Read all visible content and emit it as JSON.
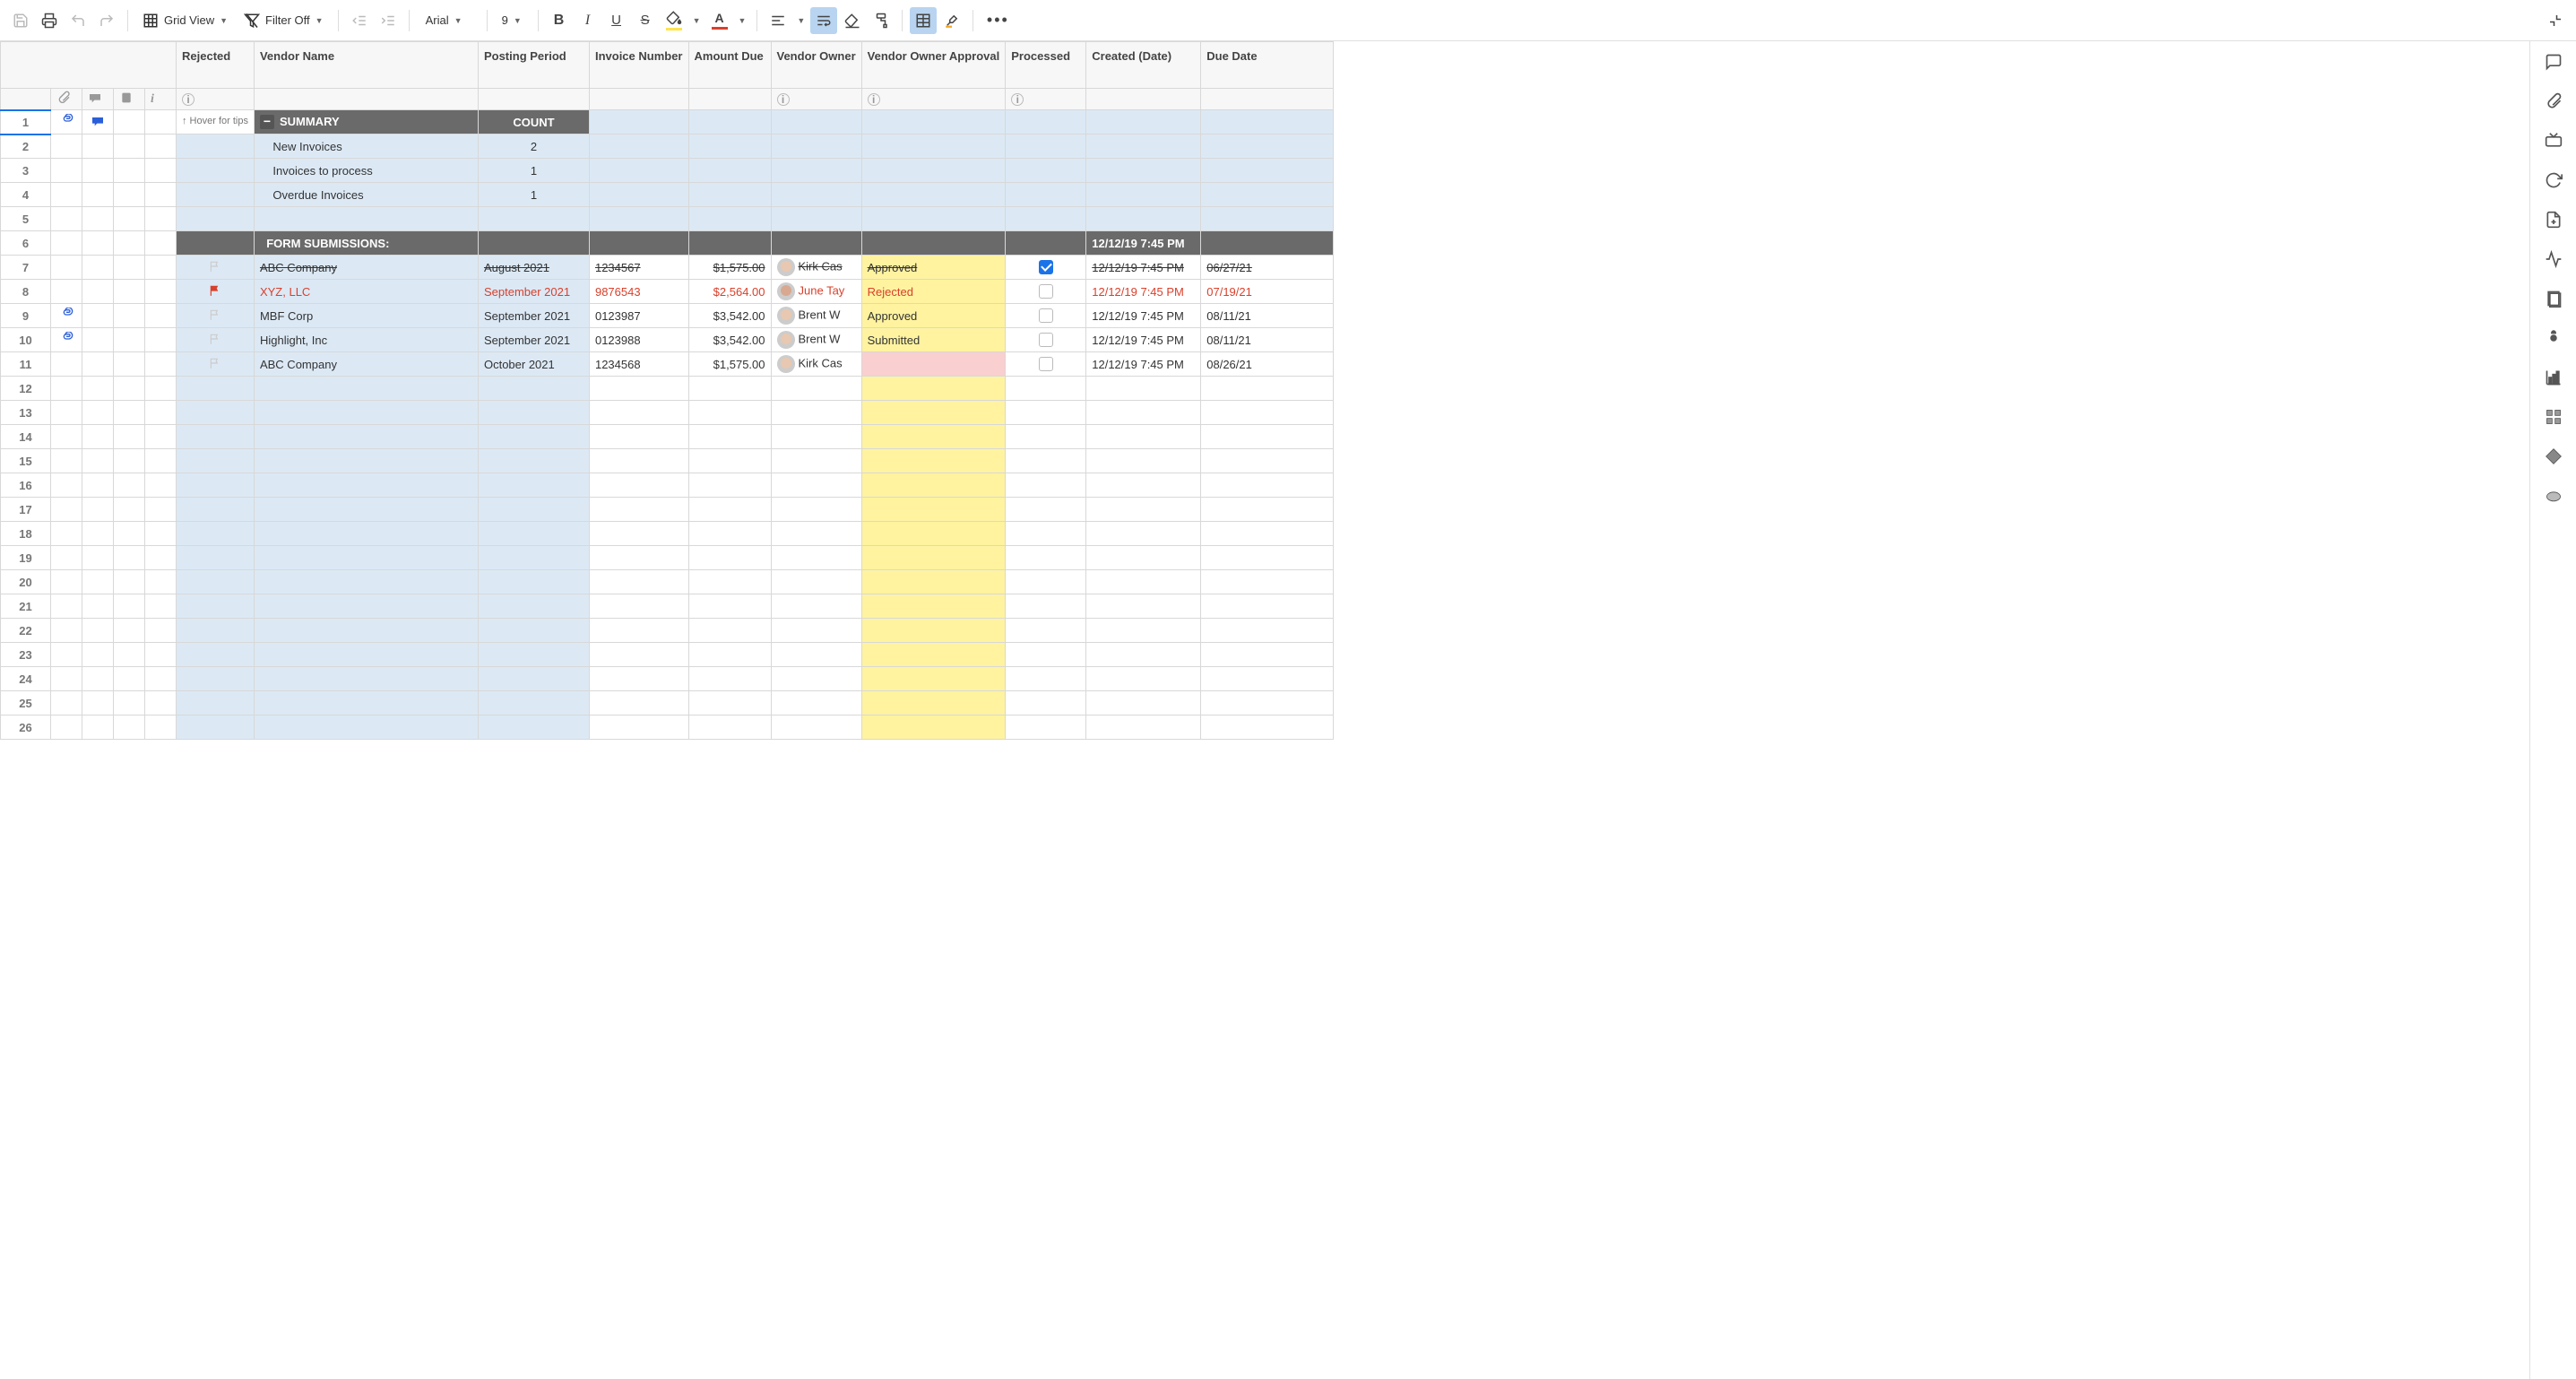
{
  "toolbar": {
    "grid_view": "Grid View",
    "filter_off": "Filter Off",
    "font": "Arial",
    "font_size": "9"
  },
  "columns": {
    "rejected": "Rejected",
    "vendor_name": "Vendor Name",
    "posting_period": "Posting Period",
    "invoice_number": "Invoice Number",
    "amount_due": "Amount Due",
    "vendor_owner": "Vendor Owner",
    "vendor_owner_approval": "Vendor Owner Approval",
    "processed": "Processed",
    "created_date": "Created (Date)",
    "due_date": "Due Date"
  },
  "hover_tip": "↑ Hover for tips",
  "summary": {
    "label": "SUMMARY",
    "count_label": "COUNT",
    "rows": [
      {
        "label": "New Invoices",
        "count": "2"
      },
      {
        "label": "Invoices to process",
        "count": "1"
      },
      {
        "label": "Overdue Invoices",
        "count": "1"
      }
    ]
  },
  "form_submissions_label": "FORM SUBMISSIONS:",
  "form_submissions_created": "12/12/19 7:45 PM",
  "rows": [
    {
      "vendor": "ABC Company",
      "period": "August 2021",
      "invoice": "1234567",
      "amount": "$1,575.00",
      "owner": "Kirk Cas",
      "approval": "Approved",
      "processed": true,
      "created": "12/12/19 7:45 PM",
      "due": "06/27/21",
      "style": "strike",
      "flag": "gray"
    },
    {
      "vendor": "XYZ, LLC",
      "period": "September 2021",
      "invoice": "9876543",
      "amount": "$2,564.00",
      "owner": "June Tay",
      "approval": "Rejected",
      "processed": false,
      "created": "12/12/19 7:45 PM",
      "due": "07/19/21",
      "style": "red",
      "flag": "red"
    },
    {
      "vendor": "MBF Corp",
      "period": "September 2021",
      "invoice": "0123987",
      "amount": "$3,542.00",
      "owner": "Brent W",
      "approval": "Approved",
      "processed": false,
      "created": "12/12/19 7:45 PM",
      "due": "08/11/21",
      "style": "",
      "flag": "gray",
      "attach": true
    },
    {
      "vendor": "Highlight, Inc",
      "period": "September 2021",
      "invoice": "0123988",
      "amount": "$3,542.00",
      "owner": "Brent W",
      "approval": "Submitted",
      "processed": false,
      "created": "12/12/19 7:45 PM",
      "due": "08/11/21",
      "style": "",
      "flag": "gray",
      "attach": true
    },
    {
      "vendor": "ABC Company",
      "period": "October 2021",
      "invoice": "1234568",
      "amount": "$1,575.00",
      "owner": "Kirk Cas",
      "approval": "",
      "processed": false,
      "created": "12/12/19 7:45 PM",
      "due": "08/26/21",
      "style": "",
      "flag": "gray",
      "approval_bg": "pink"
    }
  ]
}
